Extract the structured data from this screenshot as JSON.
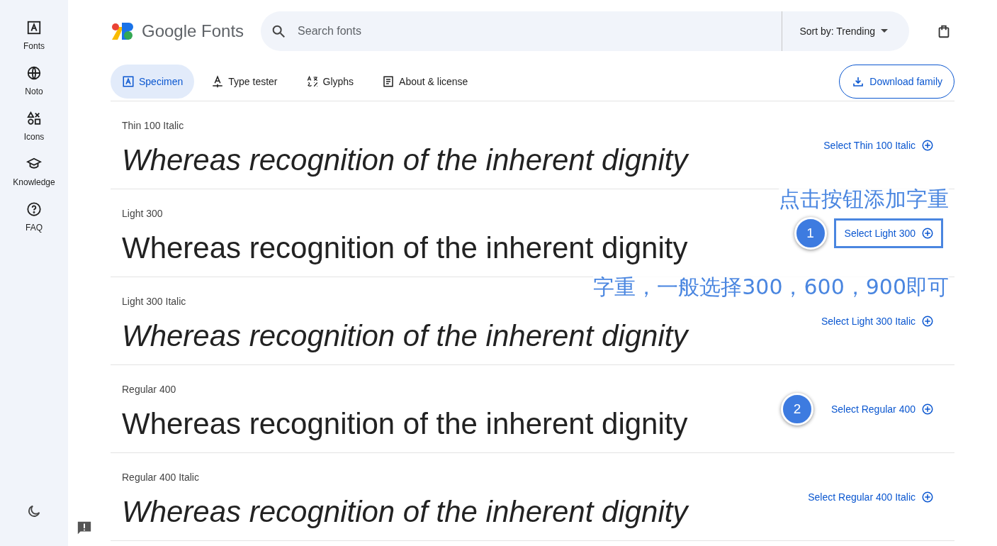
{
  "sidebar": {
    "items": [
      {
        "kind": "fonts",
        "label": "Fonts",
        "selected": false
      },
      {
        "kind": "globe",
        "label": "Noto",
        "selected": false
      },
      {
        "kind": "shapes",
        "label": "Icons",
        "selected": false
      },
      {
        "kind": "cap",
        "label": "Knowledge",
        "selected": false
      },
      {
        "kind": "help",
        "label": "FAQ",
        "selected": false
      }
    ]
  },
  "header": {
    "logo": "Google Fonts",
    "search": {
      "placeholder": "Search fonts"
    },
    "sort": "Sort by: Trending"
  },
  "tabs": [
    {
      "kind": "specimen",
      "label": "Specimen",
      "selected": true
    },
    {
      "kind": "tester",
      "label": "Type tester",
      "selected": false
    },
    {
      "kind": "glyphs",
      "label": "Glyphs",
      "selected": false
    },
    {
      "kind": "about",
      "label": "About & license",
      "selected": false
    }
  ],
  "download_button": "Download family",
  "styles": [
    {
      "label": "Thin 100 Italic",
      "italic": true,
      "sample": "Whereas recognition of the inherent dignity",
      "button": "Select Thin 100 Italic",
      "highlighted": false
    },
    {
      "label": "Light 300",
      "italic": false,
      "sample": "Whereas recognition of the inherent dignity",
      "button": "Select Light 300",
      "highlighted": true,
      "marker": "1",
      "note": "点击按钮添加字重"
    },
    {
      "label": "Light 300 Italic",
      "italic": true,
      "sample": "Whereas recognition of the inherent dignity",
      "button": "Select Light 300 Italic",
      "highlighted": false,
      "note": "字重，一般选择300，600，900即可"
    },
    {
      "label": "Regular 400",
      "italic": false,
      "sample": "Whereas recognition of the inherent dignity",
      "button": "Select Regular 400",
      "highlighted": false,
      "marker": "2"
    },
    {
      "label": "Regular 400 Italic",
      "italic": true,
      "sample": "Whereas recognition of the inherent dignity",
      "button": "Select Regular 400 Italic",
      "highlighted": false
    }
  ]
}
